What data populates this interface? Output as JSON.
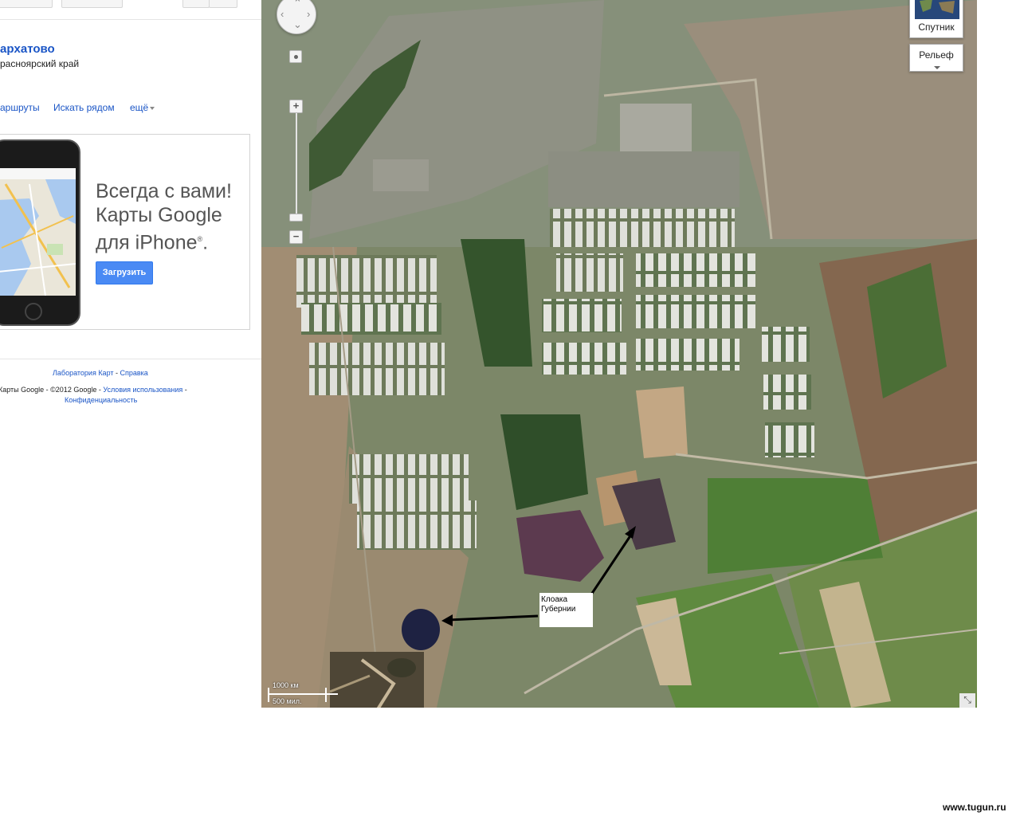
{
  "place": {
    "title": "арxатово",
    "region": "расноярский край"
  },
  "actions": {
    "routes": "аршруты",
    "nearby": "Искать рядом",
    "more": "ещё"
  },
  "promo": {
    "line1": "Всегда с вами!",
    "line2": "Карты Google",
    "line3": "для iPhone",
    "reg_mark": "®",
    "period": ".",
    "download": "Загрузить"
  },
  "footer": {
    "labs": "Лаборатория Карт",
    "sep": " - ",
    "help": "Справка",
    "copyright": "Карты Google - ©2012 Google - ",
    "terms": "Условия использования",
    "terms_sep": " -",
    "privacy": "Конфиденциальность"
  },
  "map": {
    "satellite_label": "Спутник",
    "relief_label": "Рельеф",
    "callout_line1": "Клоака",
    "callout_line2": "Губернии",
    "scale_km": "1000 км",
    "scale_mi": "500 мил.",
    "icons": {
      "zoom_in": "+",
      "zoom_out": "−",
      "fullscreen": "⤡"
    }
  },
  "watermark": "www.tugun.ru",
  "colors": {
    "link": "#1a55c6",
    "button": "#4a8af4",
    "arrow": "#000000"
  }
}
